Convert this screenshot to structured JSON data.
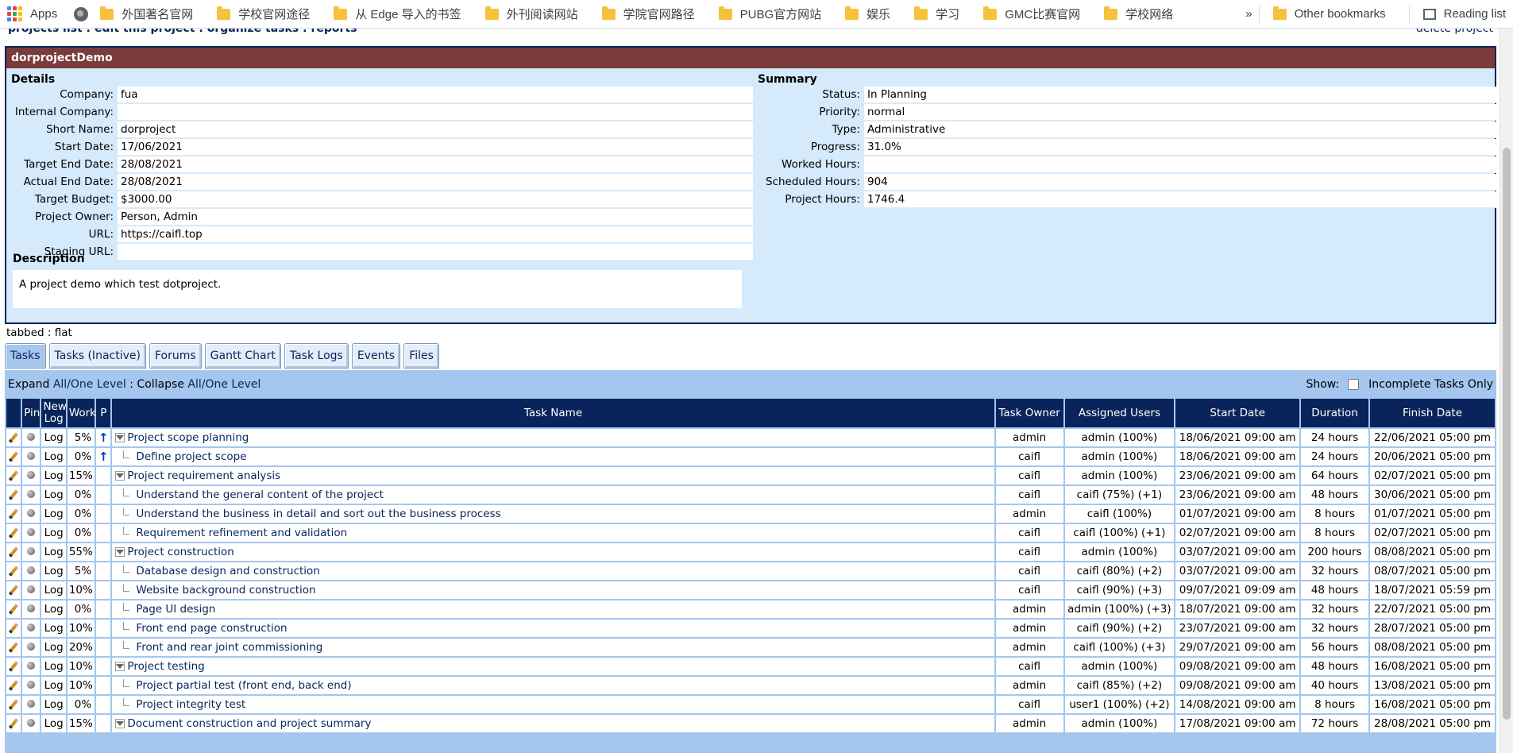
{
  "bookmarks": {
    "apps_label": "Apps",
    "items": [
      "外国著名官网",
      "学校官网途径",
      "从 Edge 导入的书签",
      "外刊阅读网站",
      "学院官网路径",
      "PUBG官方网站",
      "娱乐",
      "学习",
      "GMC比赛官网",
      "学校网络"
    ],
    "more": "»",
    "other": "Other bookmarks",
    "reading_list": "Reading list"
  },
  "nav": {
    "breadcrumb": "projects list : edit this project : organize tasks : reports",
    "delete": "delete project"
  },
  "project": {
    "title": "dorprojectDemo",
    "details_heading": "Details",
    "summary_heading": "Summary",
    "details": [
      {
        "label": "Company:",
        "value": "fua"
      },
      {
        "label": "Internal Company:",
        "value": ""
      },
      {
        "label": "Short Name:",
        "value": "dorproject"
      },
      {
        "label": "Start Date:",
        "value": "17/06/2021"
      },
      {
        "label": "Target End Date:",
        "value": "28/08/2021"
      },
      {
        "label": "Actual End Date:",
        "value": "28/08/2021"
      },
      {
        "label": "Target Budget:",
        "value": "$3000.00"
      },
      {
        "label": "Project Owner:",
        "value": "Person, Admin"
      },
      {
        "label": "URL:",
        "value": "https://caifl.top"
      },
      {
        "label": "Staging URL:",
        "value": ""
      }
    ],
    "summary": [
      {
        "label": "Status:",
        "value": "In Planning"
      },
      {
        "label": "Priority:",
        "value": "normal"
      },
      {
        "label": "Type:",
        "value": "Administrative"
      },
      {
        "label": "Progress:",
        "value": "31.0%"
      },
      {
        "label": "Worked Hours:",
        "value": ""
      },
      {
        "label": "Scheduled Hours:",
        "value": "904"
      },
      {
        "label": "Project Hours:",
        "value": "1746.4"
      }
    ],
    "description_heading": "Description",
    "description": "A project demo which test dotproject."
  },
  "view_toggle": "tabbed : flat",
  "tabs": [
    "Tasks",
    "Tasks (Inactive)",
    "Forums",
    "Gantt Chart",
    "Task Logs",
    "Events",
    "Files"
  ],
  "toolbar": {
    "expand_label": "Expand",
    "expand_links": "All/One Level",
    "collapse_sep": " : ",
    "collapse_label": "Collapse",
    "collapse_links": "All/One Level",
    "show_label": "Show:",
    "incomplete_label": "Incomplete Tasks Only"
  },
  "columns": [
    "",
    "Pin",
    "New Log",
    "Work",
    "P",
    "Task Name",
    "Task Owner",
    "Assigned Users",
    "Start Date",
    "Duration",
    "Finish Date"
  ],
  "log_label": "Log",
  "rows": [
    {
      "work": "5%",
      "prio": "up",
      "level": 0,
      "name": "Project scope planning",
      "owner": "admin",
      "assigned": "admin (100%)",
      "start": "18/06/2021 09:00 am",
      "dur": "24 hours",
      "finish": "22/06/2021 05:00 pm"
    },
    {
      "work": "0%",
      "prio": "up",
      "level": 1,
      "name": "Define project scope",
      "owner": "caifl",
      "assigned": "admin (100%)",
      "start": "18/06/2021 09:00 am",
      "dur": "24 hours",
      "finish": "20/06/2021 05:00 pm"
    },
    {
      "work": "15%",
      "prio": "",
      "level": 0,
      "name": "Project requirement analysis",
      "owner": "caifl",
      "assigned": "admin (100%)",
      "start": "23/06/2021 09:00 am",
      "dur": "64 hours",
      "finish": "02/07/2021 05:00 pm"
    },
    {
      "work": "0%",
      "prio": "",
      "level": 1,
      "name": "Understand the general content of the project",
      "owner": "caifl",
      "assigned": "caifl (75%) (+1)",
      "start": "23/06/2021 09:00 am",
      "dur": "48 hours",
      "finish": "30/06/2021 05:00 pm"
    },
    {
      "work": "0%",
      "prio": "",
      "level": 1,
      "name": "Understand the business in detail and sort out the business process",
      "owner": "admin",
      "assigned": "caifl (100%)",
      "start": "01/07/2021 09:00 am",
      "dur": "8 hours",
      "finish": "01/07/2021 05:00 pm"
    },
    {
      "work": "0%",
      "prio": "",
      "level": 1,
      "name": "Requirement refinement and validation",
      "owner": "caifl",
      "assigned": "caifl (100%) (+1)",
      "start": "02/07/2021 09:00 am",
      "dur": "8 hours",
      "finish": "02/07/2021 05:00 pm"
    },
    {
      "work": "55%",
      "prio": "",
      "level": 0,
      "name": "Project construction",
      "owner": "caifl",
      "assigned": "admin (100%)",
      "start": "03/07/2021 09:00 am",
      "dur": "200 hours",
      "finish": "08/08/2021 05:00 pm"
    },
    {
      "work": "5%",
      "prio": "",
      "level": 1,
      "name": "Database design and construction",
      "owner": "caifl",
      "assigned": "caifl (80%) (+2)",
      "start": "03/07/2021 09:00 am",
      "dur": "32 hours",
      "finish": "08/07/2021 05:00 pm"
    },
    {
      "work": "10%",
      "prio": "",
      "level": 1,
      "name": "Website background construction",
      "owner": "caifl",
      "assigned": "caifl (90%) (+3)",
      "start": "09/07/2021 09:09 am",
      "dur": "48 hours",
      "finish": "18/07/2021 05:59 pm"
    },
    {
      "work": "0%",
      "prio": "",
      "level": 1,
      "name": "Page UI design",
      "owner": "admin",
      "assigned": "admin (100%) (+3)",
      "start": "18/07/2021 09:00 am",
      "dur": "32 hours",
      "finish": "22/07/2021 05:00 pm"
    },
    {
      "work": "10%",
      "prio": "",
      "level": 1,
      "name": "Front end page construction",
      "owner": "admin",
      "assigned": "caifl (90%) (+2)",
      "start": "23/07/2021 09:00 am",
      "dur": "32 hours",
      "finish": "28/07/2021 05:00 pm"
    },
    {
      "work": "20%",
      "prio": "",
      "level": 1,
      "name": "Front and rear joint commissioning",
      "owner": "admin",
      "assigned": "caifl (100%) (+3)",
      "start": "29/07/2021 09:00 am",
      "dur": "56 hours",
      "finish": "08/08/2021 05:00 pm"
    },
    {
      "work": "10%",
      "prio": "",
      "level": 0,
      "name": "Project testing",
      "owner": "caifl",
      "assigned": "admin (100%)",
      "start": "09/08/2021 09:00 am",
      "dur": "48 hours",
      "finish": "16/08/2021 05:00 pm"
    },
    {
      "work": "10%",
      "prio": "",
      "level": 1,
      "name": "Project partial test (front end, back end)",
      "owner": "admin",
      "assigned": "caifl (85%) (+2)",
      "start": "09/08/2021 09:00 am",
      "dur": "40 hours",
      "finish": "13/08/2021 05:00 pm"
    },
    {
      "work": "0%",
      "prio": "",
      "level": 1,
      "name": "Project integrity test",
      "owner": "caifl",
      "assigned": "user1 (100%) (+2)",
      "start": "14/08/2021 09:00 am",
      "dur": "8 hours",
      "finish": "16/08/2021 05:00 pm"
    },
    {
      "work": "15%",
      "prio": "",
      "level": 0,
      "name": "Document construction and project summary",
      "owner": "admin",
      "assigned": "admin (100%)",
      "start": "17/08/2021 09:00 am",
      "dur": "72 hours",
      "finish": "28/08/2021 05:00 pm"
    }
  ]
}
